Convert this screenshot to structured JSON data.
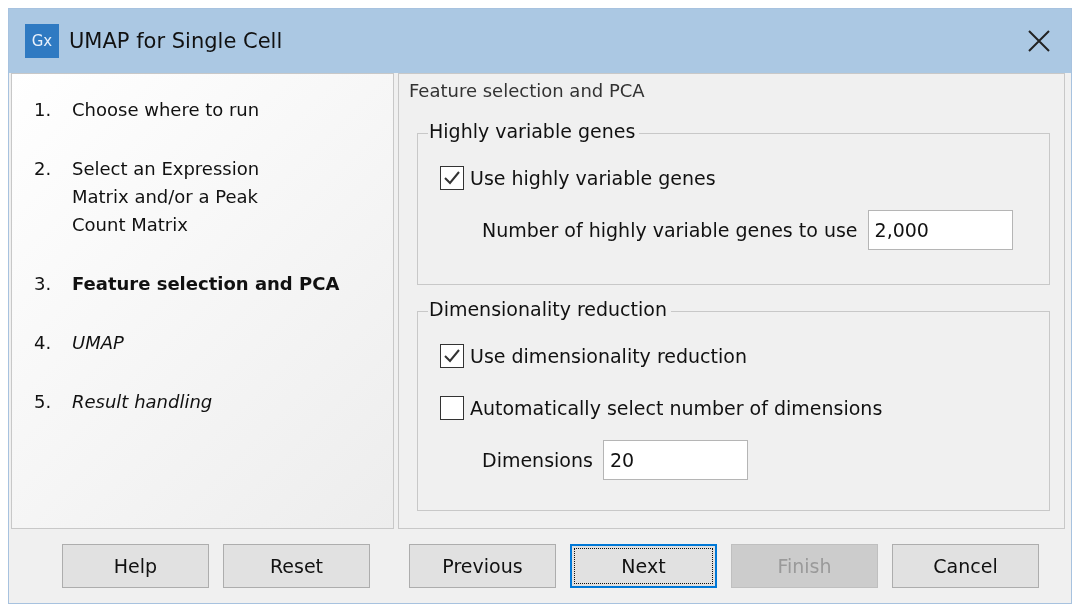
{
  "window": {
    "title": "UMAP for Single Cell",
    "app_icon": "Gx"
  },
  "steps": [
    {
      "number": "1.",
      "label": "Choose where to run",
      "selected": false,
      "pending": false
    },
    {
      "number": "2.",
      "label": "Select an Expression Matrix and/or a Peak Count Matrix",
      "selected": false,
      "pending": false
    },
    {
      "number": "3.",
      "label": "Feature selection and PCA",
      "selected": true,
      "pending": false
    },
    {
      "number": "4.",
      "label": "UMAP",
      "selected": false,
      "pending": true
    },
    {
      "number": "5.",
      "label": "Result handling",
      "selected": false,
      "pending": true
    }
  ],
  "page_title": "Feature selection and PCA",
  "groups": [
    {
      "title": "Highly variable genes",
      "items": [
        {
          "kind": "checkbox",
          "label": "Use highly variable genes",
          "checked": true
        },
        {
          "kind": "field",
          "label": "Number of highly variable genes to use",
          "value": "2,000"
        }
      ]
    },
    {
      "title": "Dimensionality reduction",
      "items": [
        {
          "kind": "checkbox",
          "label": "Use dimensionality reduction",
          "checked": true
        },
        {
          "kind": "checkbox",
          "label": "Automatically select number of dimensions",
          "checked": false
        },
        {
          "kind": "field",
          "label": "Dimensions",
          "value": "20"
        }
      ]
    }
  ],
  "buttons": [
    {
      "label": "Help",
      "focused": false,
      "disabled": false
    },
    {
      "label": "Reset",
      "focused": false,
      "disabled": false
    },
    {
      "label": "Previous",
      "focused": false,
      "disabled": false
    },
    {
      "label": "Next",
      "focused": true,
      "disabled": false
    },
    {
      "label": "Finish",
      "focused": false,
      "disabled": true
    },
    {
      "label": "Cancel",
      "focused": false,
      "disabled": false
    }
  ]
}
